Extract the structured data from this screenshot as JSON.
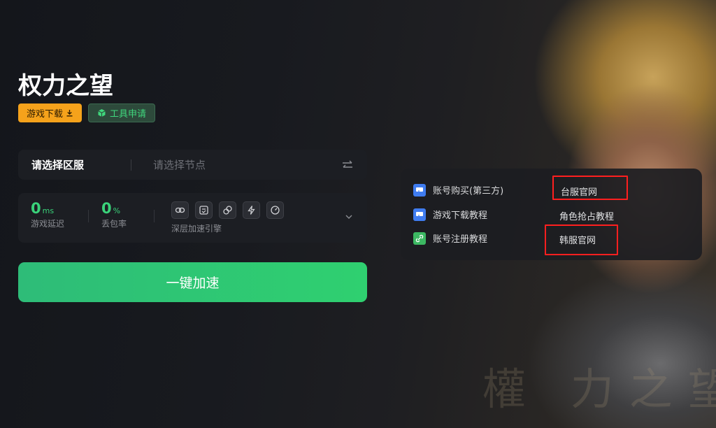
{
  "header": {
    "game_title": "权力之望",
    "download_label": "游戏下载",
    "tool_label": "工具申请"
  },
  "server_bar": {
    "server_placeholder": "请选择区服",
    "node_placeholder": "请选择节点"
  },
  "stats": {
    "latency_value": "0",
    "latency_unit": "ms",
    "latency_label": "游戏延迟",
    "packet_loss_value": "0",
    "packet_loss_unit": "%",
    "packet_loss_label": "丢包率",
    "engine_label": "深层加速引擎",
    "engine_icons": [
      "link-icon",
      "screen-icon",
      "chain-icon",
      "lightning-icon",
      "speedometer-icon"
    ]
  },
  "boost_label": "一键加速",
  "links": {
    "account_buy": "账号购买(第三方)",
    "tw_official": "台服官网",
    "download_tutorial": "游戏下载教程",
    "character_tutorial": "角色抢占教程",
    "register_tutorial": "账号注册教程",
    "kr_official": "韩服官网"
  },
  "watermark": "權 力之望",
  "colors": {
    "accent_green": "#2fd070",
    "download_orange": "#f5a21b",
    "highlight_red": "#ff1f1f"
  }
}
